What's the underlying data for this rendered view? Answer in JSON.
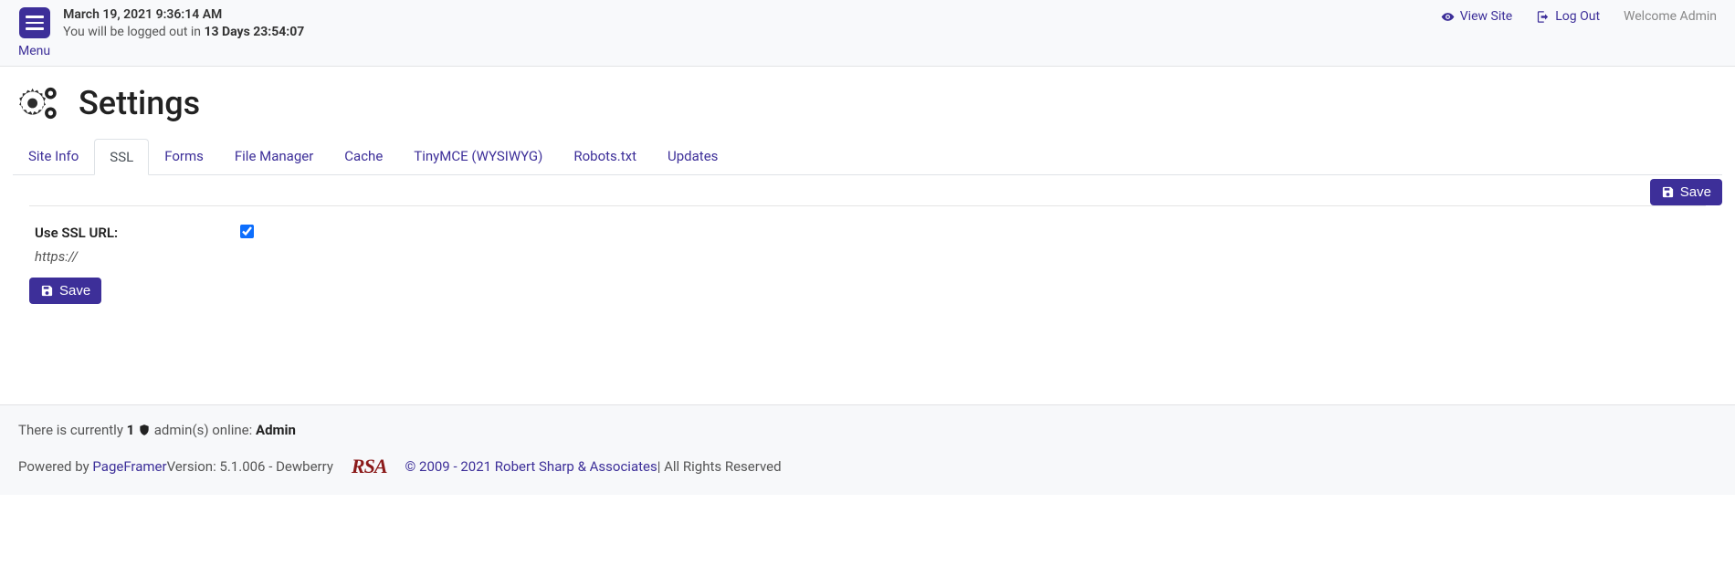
{
  "header": {
    "menu_label": "Menu",
    "datetime": "March 19, 2021 9:36:14 AM",
    "logout_prefix": "You will be logged out in ",
    "logout_time": "13 Days 23:54:07",
    "view_site": "View Site",
    "log_out": "Log Out",
    "welcome": "Welcome Admin"
  },
  "page": {
    "title": "Settings"
  },
  "tabs": {
    "site_info": "Site Info",
    "ssl": "SSL",
    "forms": "Forms",
    "file_manager": "File Manager",
    "cache": "Cache",
    "tinymce": "TinyMCE (WYSIWYG)",
    "robots": "Robots.txt",
    "updates": "Updates"
  },
  "actions": {
    "save": "Save"
  },
  "form": {
    "use_ssl_label": "Use SSL URL:",
    "use_ssl_sub": "https://"
  },
  "footer": {
    "online_prefix": "There is currently ",
    "online_count": "1",
    "online_mid": " admin(s) online: ",
    "online_name": "Admin",
    "powered_by": "Powered by ",
    "pageframer": "PageFramer",
    "version": " Version: 5.1.006 - Dewberry",
    "rsa": "RSA",
    "copyright_link": "© 2009 - 2021 Robert Sharp & Associates",
    "rights": " | All Rights Reserved"
  }
}
